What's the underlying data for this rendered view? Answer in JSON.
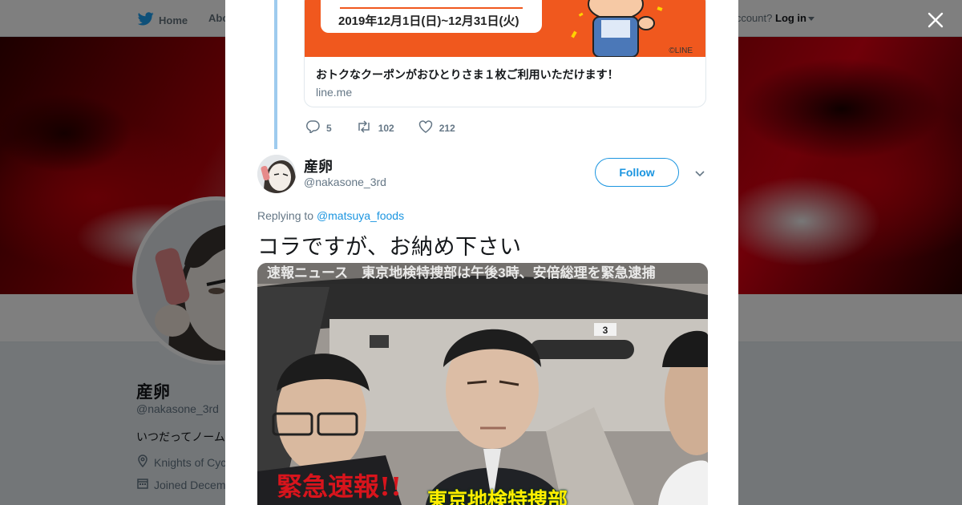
{
  "background": {
    "nav": {
      "home_label": "Home",
      "about_label": "Abo",
      "account_prompt": "ccount?",
      "login_label": "Log in"
    },
    "profile": {
      "name": "産卵",
      "handle": "@nakasone_3rd",
      "bio": "いつだってノーム",
      "location": "Knights of Cyc",
      "joined": "Joined Decem"
    }
  },
  "modal": {
    "link_card": {
      "image_date": "2019年12月1日(日)~12月31日(火)",
      "image_credit": "©LINE",
      "title": "おトクなクーポンがおひとりさま１枚ご利用いただけます！",
      "domain": "line.me"
    },
    "actions": {
      "reply_count": "5",
      "retweet_count": "102",
      "like_count": "212"
    },
    "tweet": {
      "author_name": "産卵",
      "author_handle": "@nakasone_3rd",
      "follow_label": "Follow",
      "replying_prefix": "Replying to",
      "replying_to": "@matsuya_foods",
      "text": "コラですが、お納め下さい",
      "photo_ticker": "速報ニュース　東京地検特捜部は午後3時、安倍総理を緊急逮捕",
      "photo_alert": "緊急速報!!",
      "photo_caption": "東京地検特捜部",
      "photo_plate": "3"
    }
  },
  "colors": {
    "brand_blue": "#1b95e0",
    "thread_line": "#9ecbee",
    "card_orange": "#f0581e",
    "alert_red": "#d8141c",
    "caption_yellow": "#ffee00"
  },
  "icons": [
    "twitter-bird-icon",
    "close-icon",
    "reply-icon",
    "retweet-icon",
    "heart-icon",
    "chevron-down-icon",
    "location-icon",
    "calendar-icon"
  ]
}
